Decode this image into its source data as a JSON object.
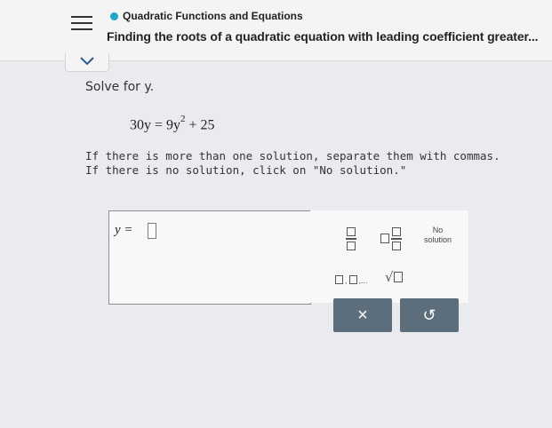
{
  "header": {
    "topic": "Quadratic Functions and Equations",
    "subtitle": "Finding the roots of a quadratic equation with leading coefficient greater..."
  },
  "question": {
    "prompt": "Solve for y.",
    "equation_lhs": "30y = 9y",
    "equation_exp": "2",
    "equation_rhs": " + 25",
    "instruction_1": "If there is more than one solution, separate them with commas.",
    "instruction_2": "If there is no solution, click on \"No solution.\""
  },
  "answer": {
    "label": "y =",
    "value": ""
  },
  "keypad": {
    "no_solution_line1": "No",
    "no_solution_line2": "solution",
    "list_separator": ",...",
    "sqrt_symbol": "√",
    "clear_symbol": "×",
    "undo_symbol": "↺"
  },
  "colors": {
    "accent_dot": "#1aa7c9",
    "action_button": "#5c6e7b"
  }
}
